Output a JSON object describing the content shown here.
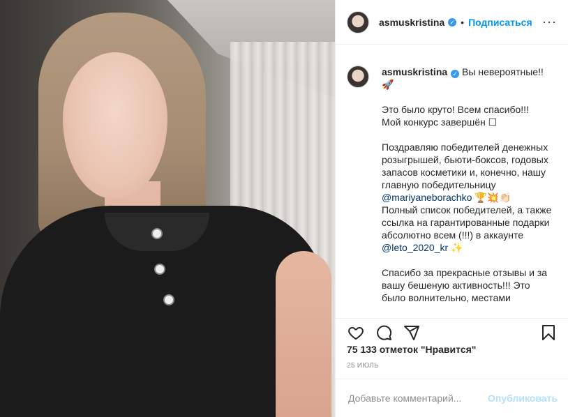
{
  "post": {
    "image_alt": "Фото",
    "author": {
      "username": "asmuskristina",
      "verified_icon": "verified-badge-icon",
      "follow_label": "Подписаться",
      "dot": "•",
      "more": "···"
    },
    "caption": {
      "username": "asmuskristina",
      "intro": " Вы невероятные!! 🚀",
      "p1": "Это было круто! Всем спасибо!!!\nМой конкурс завершён ☐",
      "p2": "Поздравляю победителей денежных розыгрышей, бьюти-боксов, годовых запасов косметики и, конечно, нашу главную победительницу ",
      "mention1": "@mariyaneborachko",
      "p2_emoji": " 🏆💥👏🏻",
      "p3": "Полный список победителей, а также ссылка на гарантированные подарки абсолютно всем (!!!) в аккаунте ",
      "mention2": "@leto_2020_kr",
      "p3_emoji": " ✨",
      "p4": "Спасибо за прекрасные отзывы и за вашу бешеную активность!!! Это было волнительно, местами"
    },
    "actions": {
      "like_icon": "heart-icon",
      "comment_icon": "comment-icon",
      "share_icon": "share-icon",
      "save_icon": "bookmark-icon"
    },
    "likes": "75 133 отметок \"Нравится\"",
    "date": "25 ИЮЛЬ",
    "comment": {
      "placeholder": "Добавьте комментарий...",
      "submit_label": "Опубликовать"
    }
  },
  "colors": {
    "link": "#0095f6",
    "mention": "#00376b",
    "muted": "#8e8e8e",
    "post_disabled": "#b2dffc"
  }
}
